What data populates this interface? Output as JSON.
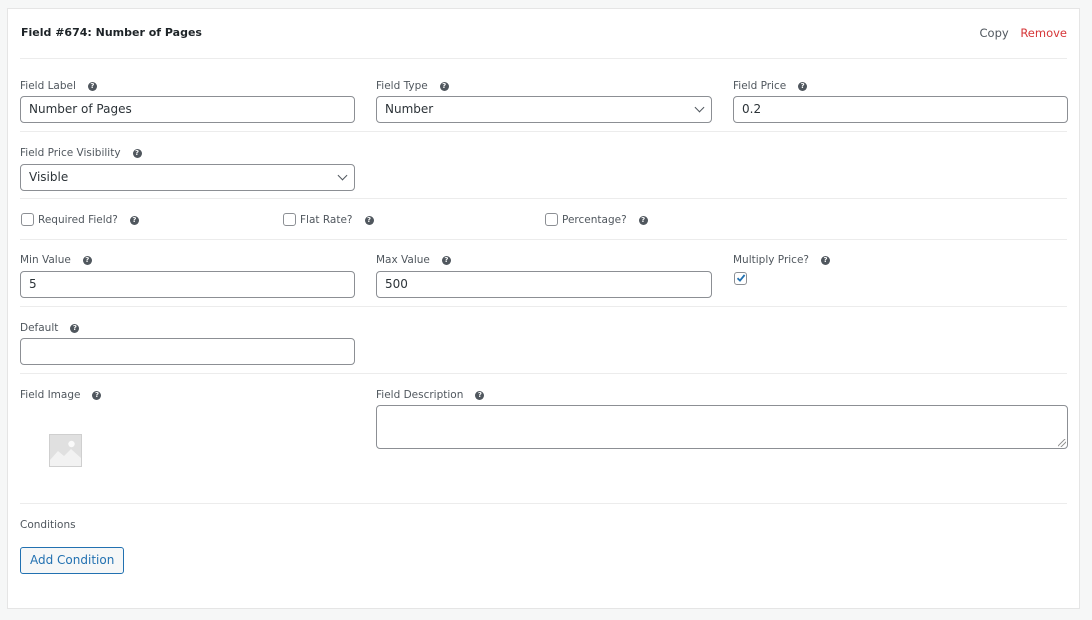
{
  "header": {
    "title": "Field #674: Number of Pages",
    "copy_label": "Copy",
    "remove_label": "Remove"
  },
  "fields": {
    "field_label": {
      "label": "Field Label",
      "value": "Number of Pages"
    },
    "field_type": {
      "label": "Field Type",
      "selected": "Number"
    },
    "field_price": {
      "label": "Field Price",
      "value": "0.2"
    },
    "price_visibility": {
      "label": "Field Price Visibility",
      "selected": "Visible"
    },
    "required": {
      "label": "Required Field?",
      "checked": false
    },
    "flat_rate": {
      "label": "Flat Rate?",
      "checked": false
    },
    "percentage": {
      "label": "Percentage?",
      "checked": false
    },
    "min_value": {
      "label": "Min Value",
      "value": "5"
    },
    "max_value": {
      "label": "Max Value",
      "value": "500"
    },
    "multiply_price": {
      "label": "Multiply Price?",
      "checked": true
    },
    "default": {
      "label": "Default",
      "value": ""
    },
    "field_image": {
      "label": "Field Image"
    },
    "field_description": {
      "label": "Field Description",
      "value": ""
    }
  },
  "conditions": {
    "label": "Conditions",
    "add_button_label": "Add Condition"
  },
  "help_glyph": "?",
  "colors": {
    "accent": "#2271b1",
    "danger": "#d63638"
  }
}
